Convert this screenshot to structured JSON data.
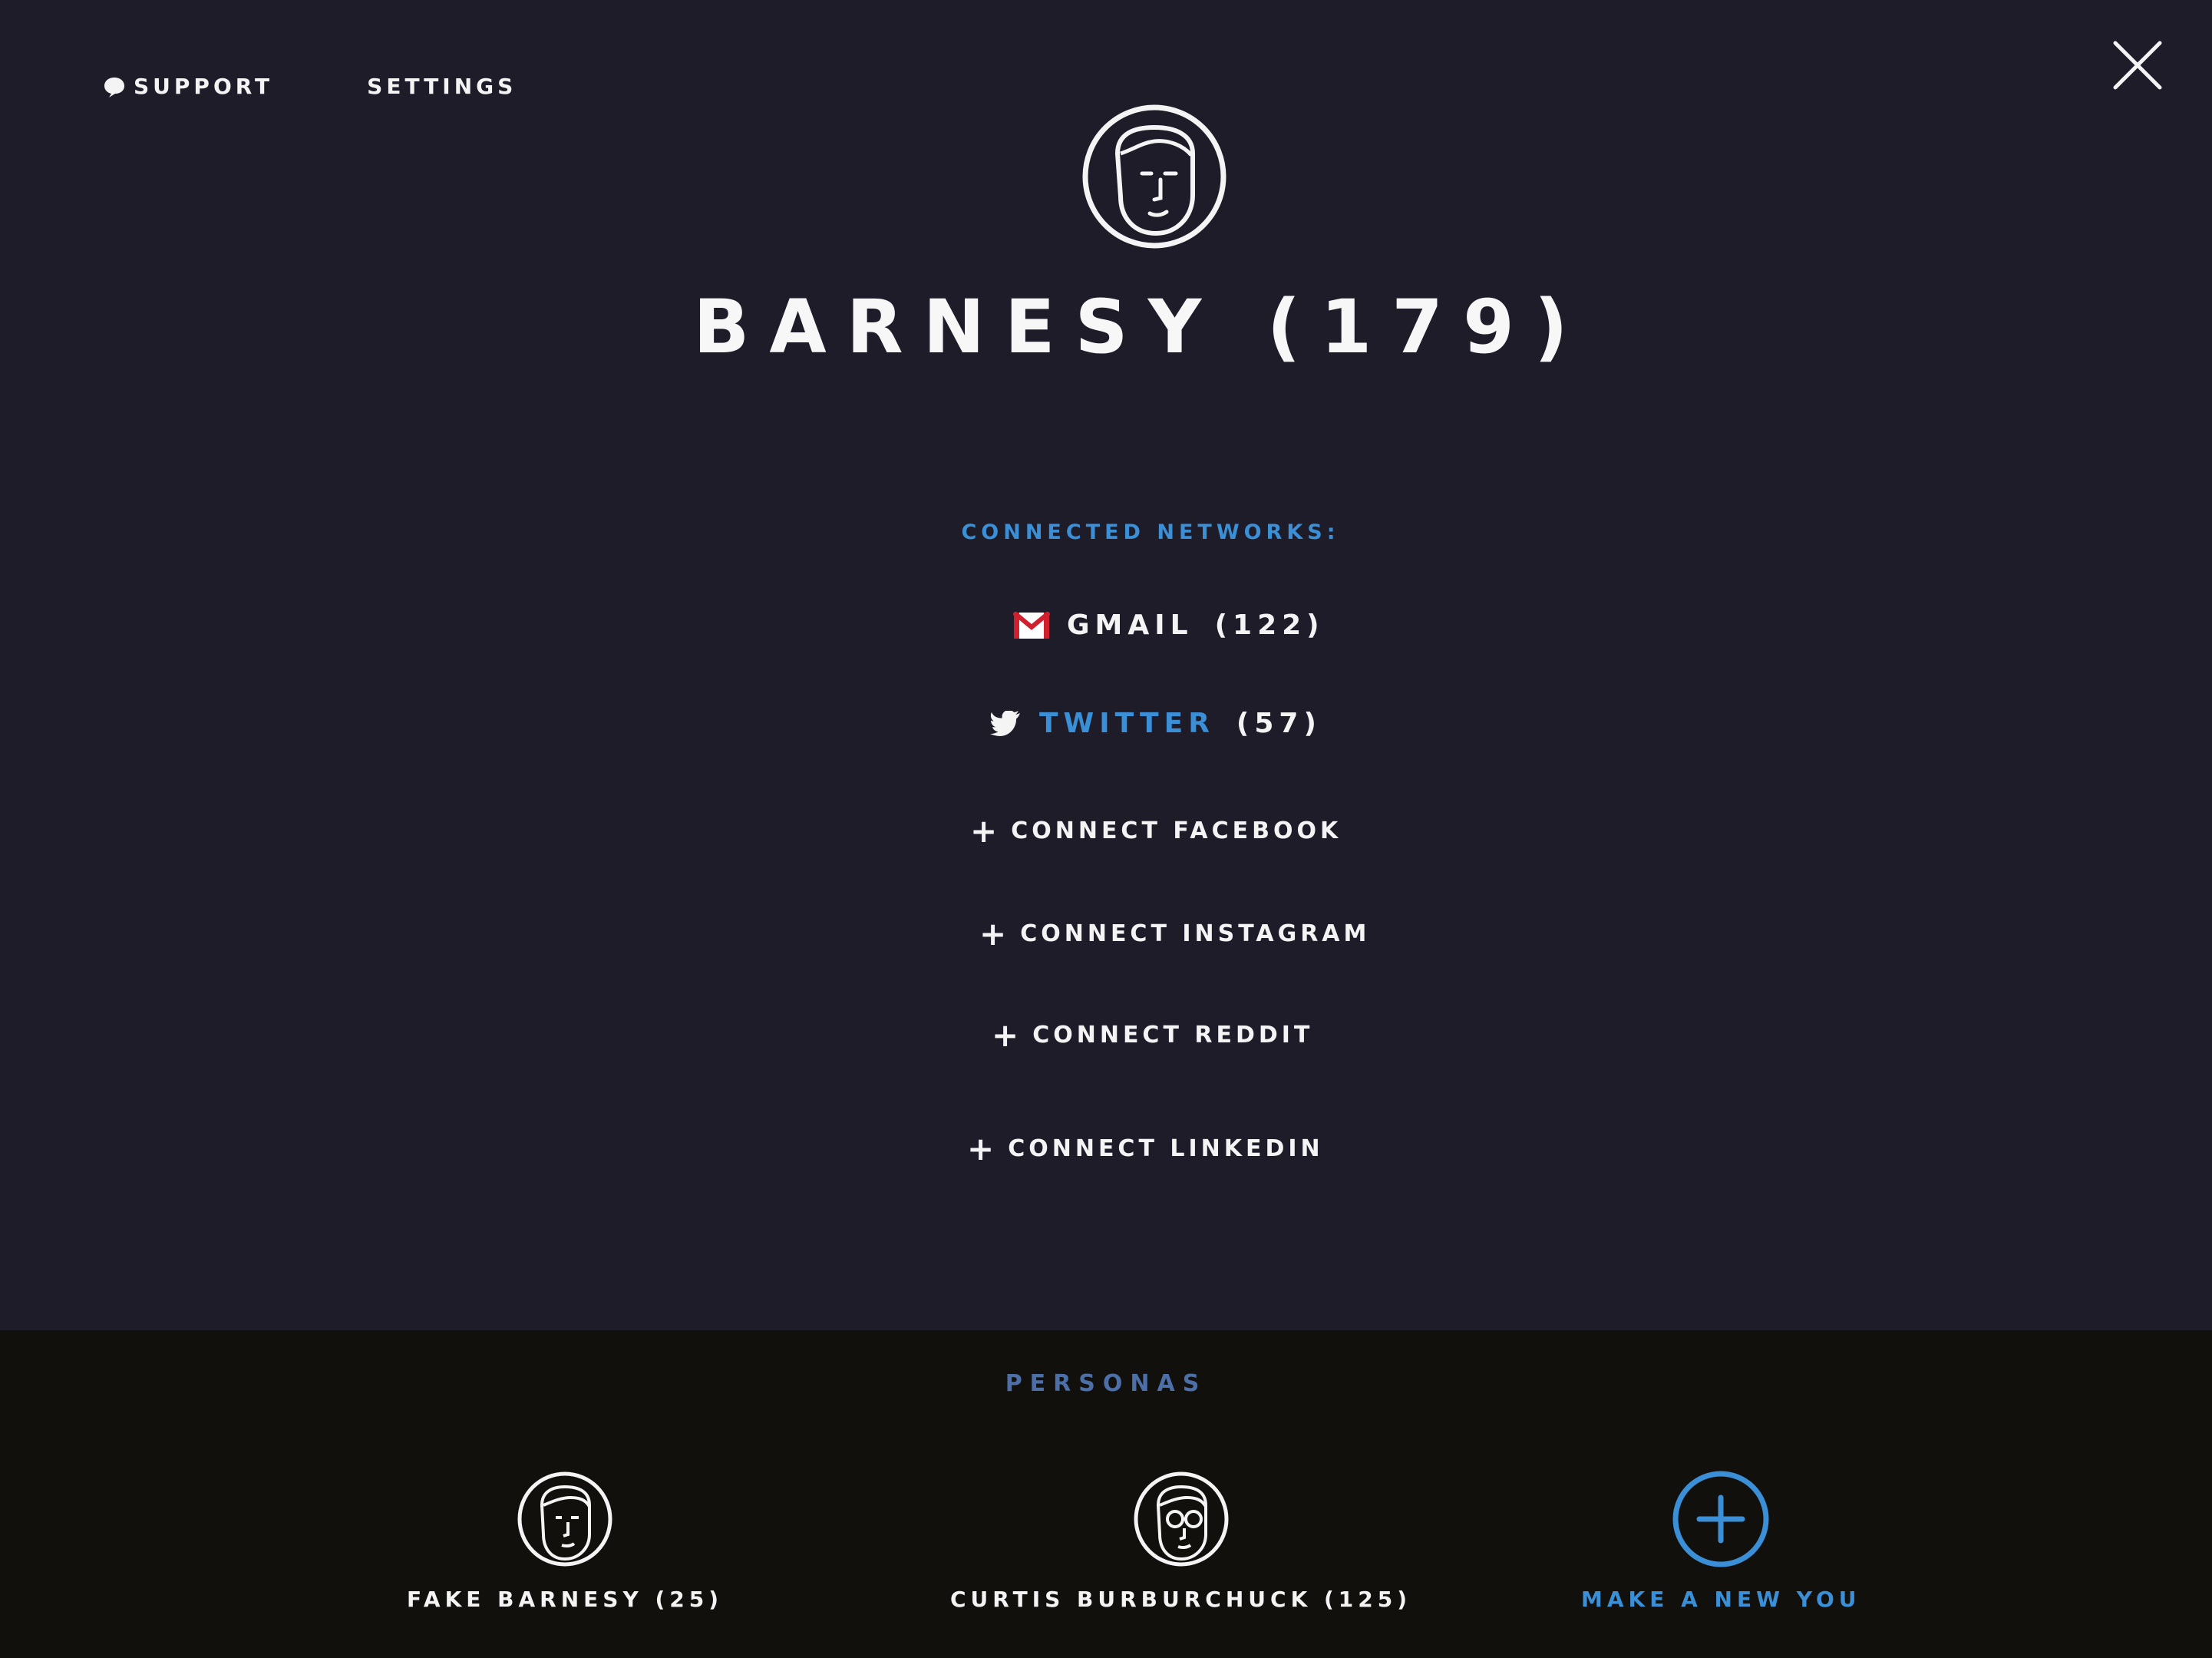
{
  "nav": {
    "support_label": "SUPPORT",
    "settings_label": "SETTINGS"
  },
  "profile": {
    "name": "BARNESY (179)"
  },
  "networks": {
    "heading": "CONNECTED NETWORKS:",
    "connected": [
      {
        "name": "GMAIL",
        "count": "(122)",
        "icon": "gmail-icon"
      },
      {
        "name": "TWITTER",
        "count": "(57)",
        "icon": "twitter-icon"
      }
    ],
    "connect_actions": [
      {
        "label": "CONNECT FACEBOOK"
      },
      {
        "label": "CONNECT INSTAGRAM"
      },
      {
        "label": "CONNECT REDDIT"
      },
      {
        "label": "CONNECT LINKEDIN"
      }
    ],
    "plus_glyph": "+"
  },
  "personas": {
    "title": "PERSONAS",
    "items": [
      {
        "label": "FAKE BARNESY (25)"
      },
      {
        "label": "CURTIS BURBURCHUCK (125)"
      }
    ],
    "new_label": "MAKE A NEW YOU"
  },
  "colors": {
    "background": "#1e1c29",
    "personas_background": "#11100d",
    "accent_blue": "#3a8fd6",
    "gmail_red": "#d0202e"
  }
}
